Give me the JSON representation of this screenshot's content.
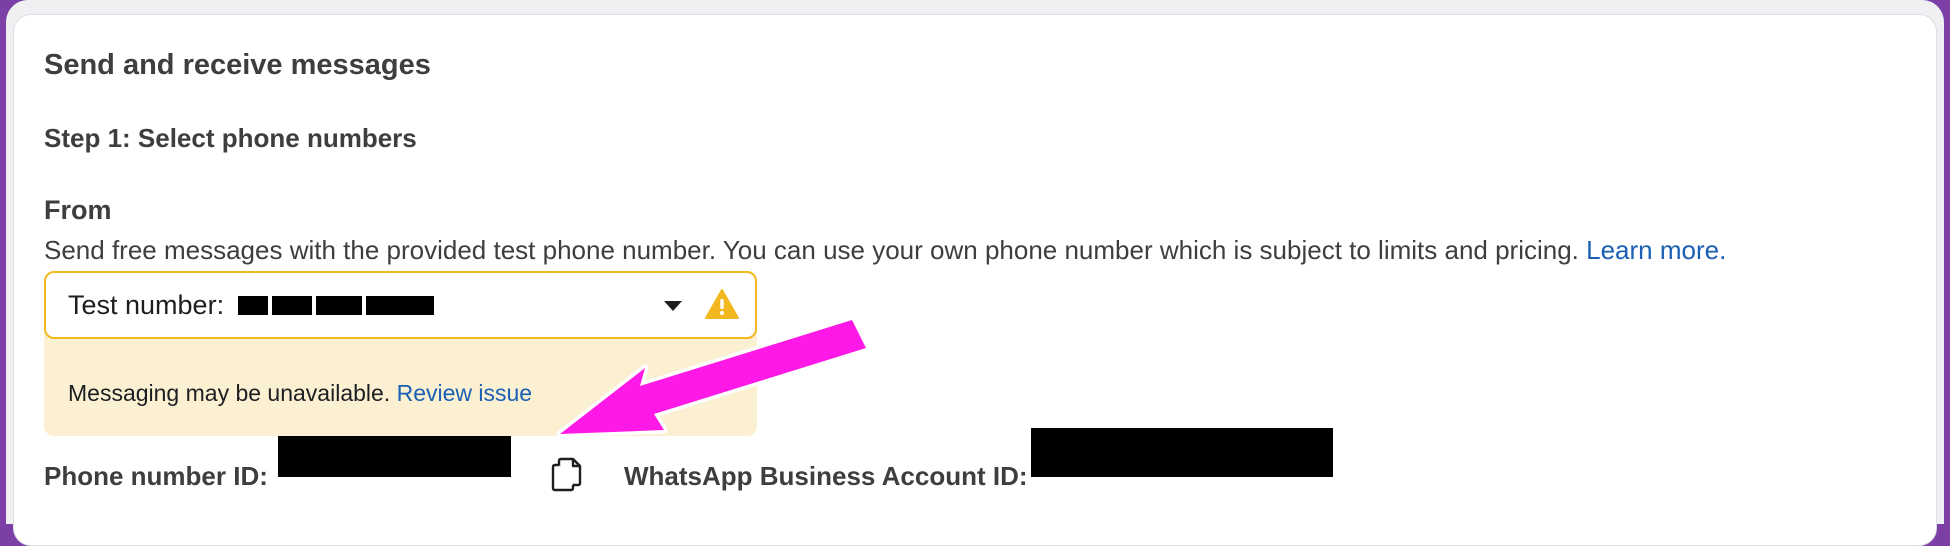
{
  "section": {
    "title": "Send and receive messages",
    "step_title": "Step 1: Select phone numbers"
  },
  "from": {
    "label": "From",
    "description": "Send free messages with the provided test phone number. You can use your own phone number which is subject to limits and pricing.",
    "learn_more": "Learn more."
  },
  "phone_select": {
    "label": "Test number:",
    "value_redacted": true
  },
  "warning": {
    "message": "Messaging may be unavailable.",
    "link": "Review issue"
  },
  "ids": {
    "phone_number_id_label": "Phone number ID:",
    "waba_id_label": "WhatsApp Business Account ID:",
    "values_redacted": true
  },
  "colors": {
    "link": "#1a5fb4",
    "warning_border": "#f3b81f",
    "warning_background": "#fbf0d2",
    "annotation_arrow": "#ff19e6"
  },
  "icons": [
    "chevron-down-icon",
    "warning-icon",
    "copy-icon"
  ]
}
